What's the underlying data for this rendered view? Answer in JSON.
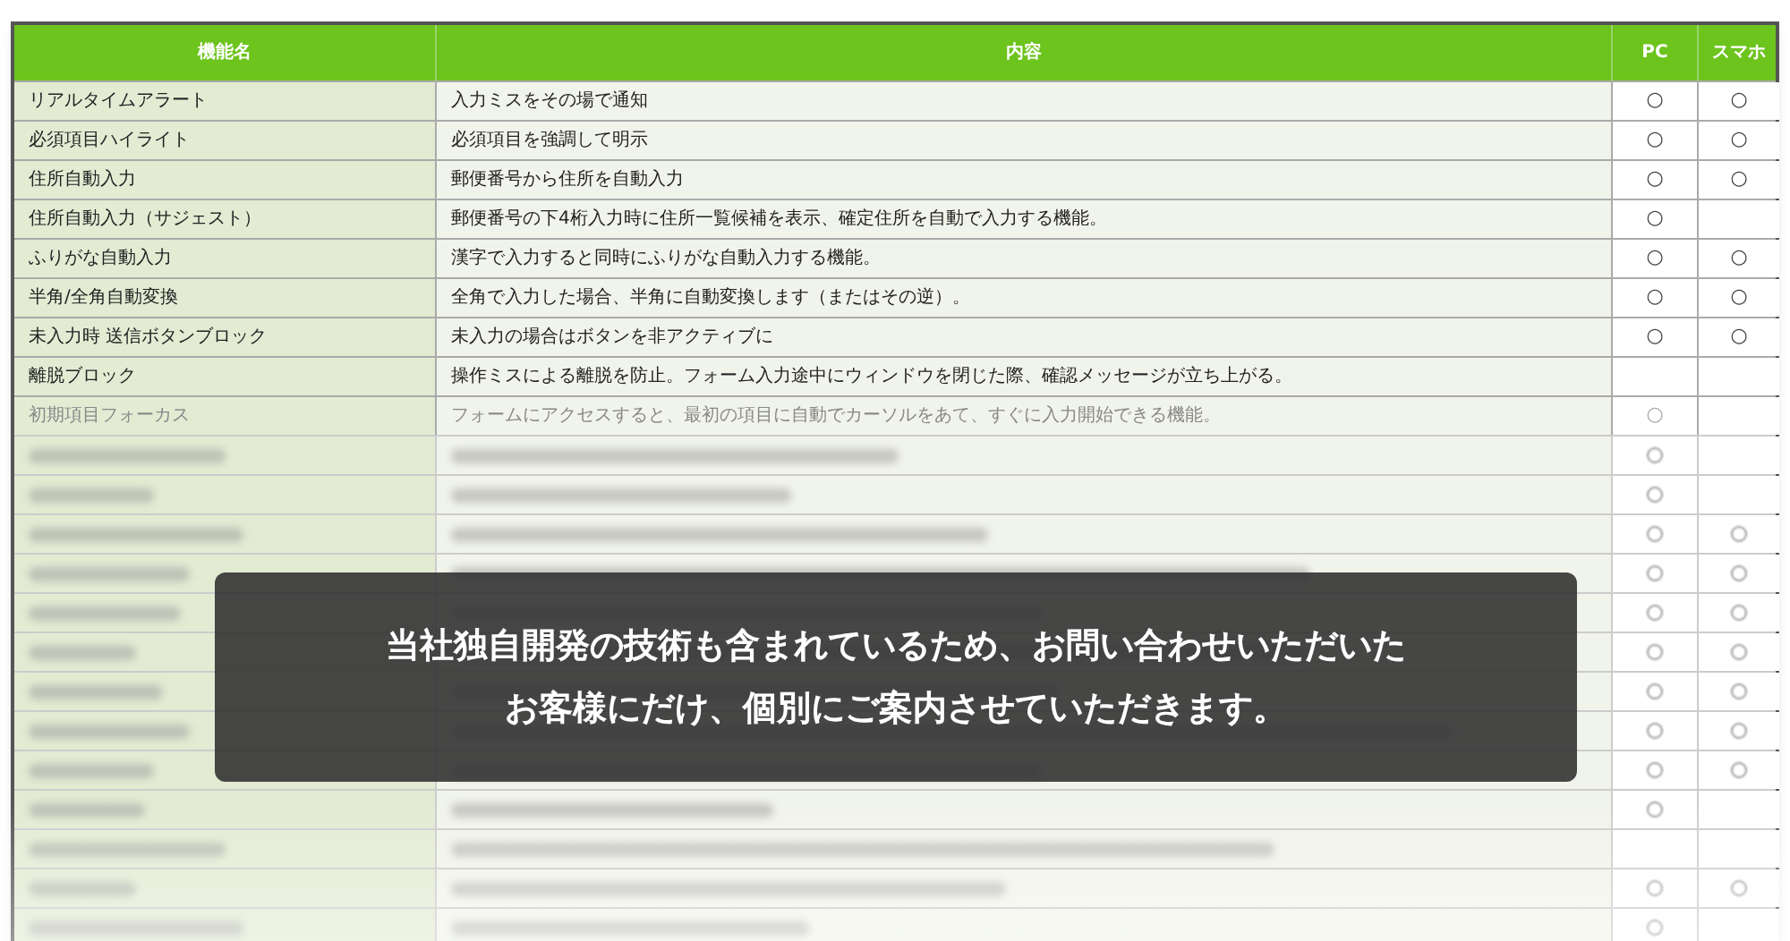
{
  "table": {
    "columns": [
      "機能名",
      "内容",
      "PC",
      "スマホ"
    ],
    "rows": [
      {
        "name": "リアルタイムアラート",
        "content": "入力ミスをその場で通知",
        "pc": true,
        "sp": true,
        "faded": false
      },
      {
        "name": "必須項目ハイライト",
        "content": "必須項目を強調して明示",
        "pc": true,
        "sp": true,
        "faded": false
      },
      {
        "name": "住所自動入力",
        "content": "郵便番号から住所を自動入力",
        "pc": true,
        "sp": true,
        "faded": false
      },
      {
        "name": "住所自動入力（サジェスト）",
        "content": "郵便番号の下4桁入力時に住所一覧候補を表示、確定住所を自動で入力する機能。",
        "pc": true,
        "sp": false,
        "faded": false
      },
      {
        "name": "ふりがな自動入力",
        "content": "漢字で入力すると同時にふりがな自動入力する機能。",
        "pc": true,
        "sp": true,
        "faded": false
      },
      {
        "name": "半角/全角自動変換",
        "content": "全角で入力した場合、半角に自動変換します（またはその逆）。",
        "pc": true,
        "sp": true,
        "faded": false
      },
      {
        "name": "未入力時 送信ボタンブロック",
        "content": "未入力の場合はボタンを非アクティブに",
        "pc": true,
        "sp": true,
        "faded": false
      },
      {
        "name": "離脱ブロック",
        "content": "操作ミスによる離脱を防止。フォーム入力途中にウィンドウを閉じた際、確認メッセージが立ち上がる。",
        "pc": false,
        "sp": false,
        "faded": false
      },
      {
        "name": "初期項目フォーカス",
        "content": "フォームにアクセスすると、最初の項目に自動でカーソルをあて、すぐに入力開始できる機能。",
        "pc": true,
        "sp": false,
        "faded": true
      }
    ],
    "mark": "○",
    "blurred_rows": [
      {
        "pc": true,
        "sp": false
      },
      {
        "pc": true,
        "sp": false
      },
      {
        "pc": true,
        "sp": true
      },
      {
        "pc": true,
        "sp": true
      },
      {
        "pc": true,
        "sp": true
      },
      {
        "pc": true,
        "sp": true
      },
      {
        "pc": true,
        "sp": true
      },
      {
        "pc": true,
        "sp": true
      },
      {
        "pc": true,
        "sp": true
      },
      {
        "pc": true,
        "sp": false
      },
      {
        "pc": false,
        "sp": false
      },
      {
        "pc": true,
        "sp": true
      },
      {
        "pc": true,
        "sp": false
      }
    ]
  },
  "overlay": {
    "lines": [
      "当社独自開発の技術も含まれているため、お問い合わせいただいた",
      "お客様にだけ、個別にご案内させていただきます。"
    ]
  }
}
